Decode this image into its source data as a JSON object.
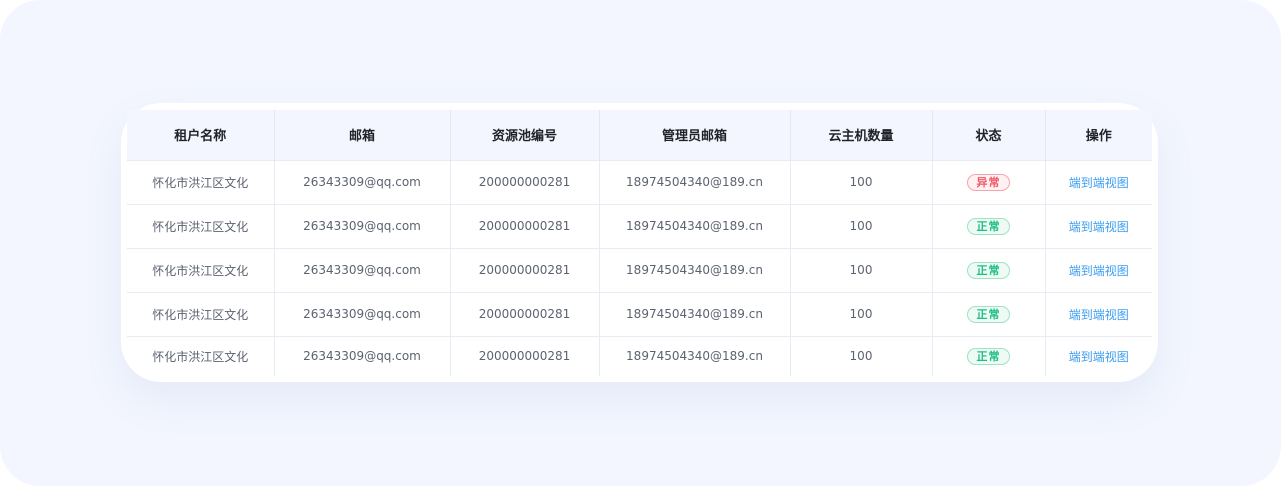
{
  "table": {
    "headers": [
      "租户名称",
      "邮箱",
      "资源池编号",
      "管理员邮箱",
      "云主机数量",
      "状态",
      "操作"
    ],
    "rows": [
      {
        "tenant": "怀化市洪江区文化",
        "email": "26343309@qq.com",
        "pool_id": "200000000281",
        "admin_email": "18974504340@189.cn",
        "vm_count": "100",
        "status": "异常",
        "status_type": "abnormal",
        "action": "端到端视图"
      },
      {
        "tenant": "怀化市洪江区文化",
        "email": "26343309@qq.com",
        "pool_id": "200000000281",
        "admin_email": "18974504340@189.cn",
        "vm_count": "100",
        "status": "正常",
        "status_type": "normal",
        "action": "端到端视图"
      },
      {
        "tenant": "怀化市洪江区文化",
        "email": "26343309@qq.com",
        "pool_id": "200000000281",
        "admin_email": "18974504340@189.cn",
        "vm_count": "100",
        "status": "正常",
        "status_type": "normal",
        "action": "端到端视图"
      },
      {
        "tenant": "怀化市洪江区文化",
        "email": "26343309@qq.com",
        "pool_id": "200000000281",
        "admin_email": "18974504340@189.cn",
        "vm_count": "100",
        "status": "正常",
        "status_type": "normal",
        "action": "端到端视图"
      },
      {
        "tenant": "怀化市洪江区文化",
        "email": "26343309@qq.com",
        "pool_id": "200000000281",
        "admin_email": "18974504340@189.cn",
        "vm_count": "100",
        "status": "正常",
        "status_type": "normal",
        "action": "端到端视图"
      }
    ]
  },
  "colors": {
    "background": "#f3f6fe",
    "header_bg": "#f3f6fe",
    "status_abnormal": "#f0596a",
    "status_normal": "#1fbf86",
    "link": "#3a9cf2"
  }
}
